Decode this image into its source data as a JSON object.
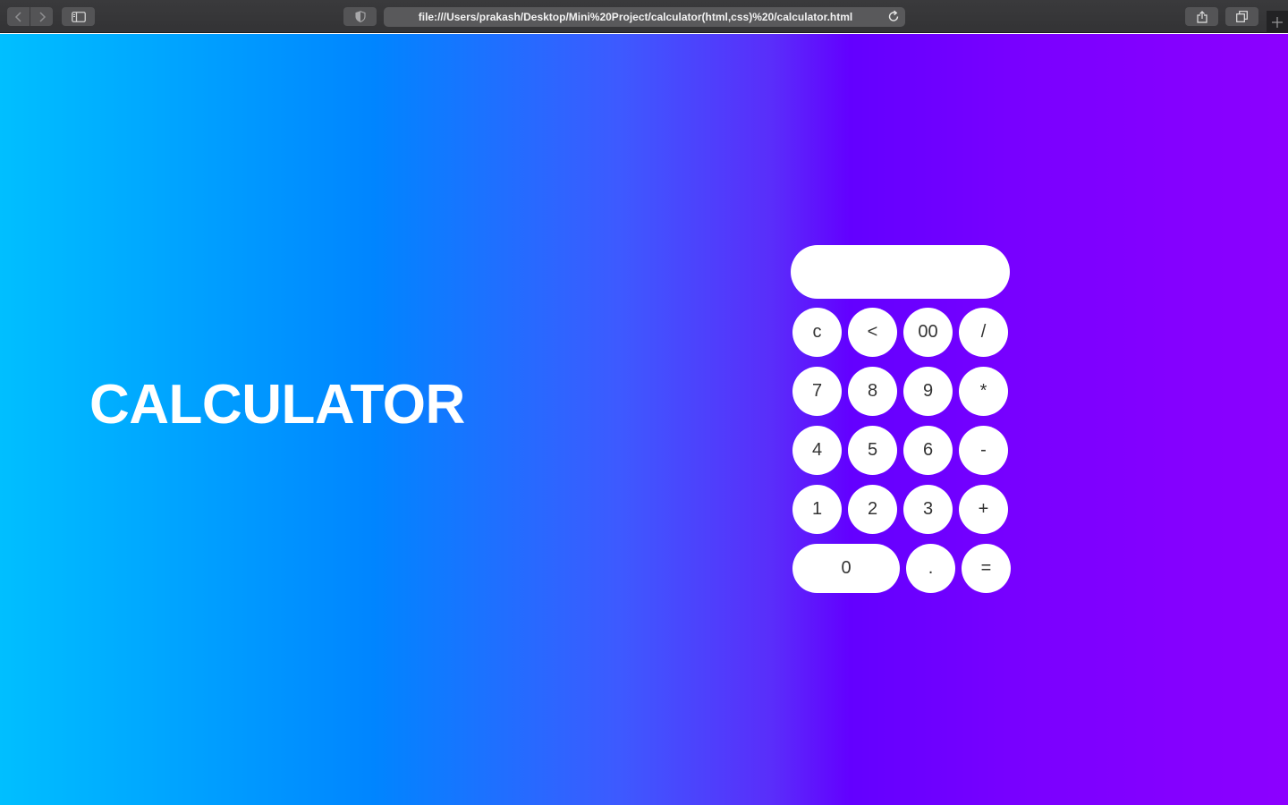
{
  "browser": {
    "url": "file:///Users/prakash/Desktop/Mini%20Project/calculator(html,css)%20/calculator.html"
  },
  "page": {
    "title": "CALCULATOR",
    "display_value": ""
  },
  "keys": {
    "clear": "c",
    "backspace": "<",
    "double_zero": "00",
    "divide": "/",
    "seven": "7",
    "eight": "8",
    "nine": "9",
    "multiply": "*",
    "four": "4",
    "five": "5",
    "six": "6",
    "subtract": "-",
    "one": "1",
    "two": "2",
    "three": "3",
    "add": "+",
    "zero": "0",
    "decimal": ".",
    "equals": "="
  },
  "colors": {
    "gradient_start": "#00bfff",
    "gradient_mid": "#0085ff",
    "gradient_violet": "#6300ff",
    "gradient_end": "#8c00ff",
    "key_background": "#ffffff",
    "key_text": "#333333",
    "title_text": "#ffffff"
  }
}
